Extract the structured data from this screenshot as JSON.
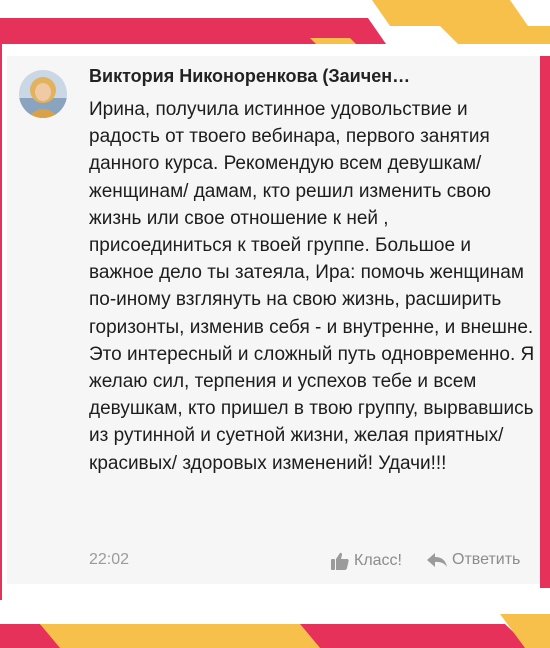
{
  "comment": {
    "author": "Виктория Никоноренкова (Заичен…",
    "text": "Ирина, получила истинное  удовольствие и радость от  твоего  вебинара, первого занятия данного курса.  Рекомендую всем девушкам/ женщинам/ дамам, кто решил изменить свою жизнь или свое отношение к ней , присоединиться к твоей группе. Большое и важное дело ты затеяла, Ира: помочь женщинам по-иному взглянуть на свою жизнь, расширить горизонты, изменив себя - и внутренне, и внешне. Это интересный и сложный путь одновременно. Я желаю сил, терпения и успехов тебе и всем девушкам, кто пришел в твою группу, вырвавшись из рутинной и суетной жизни, желая приятных/ красивых/ здоровых изменений! Удачи!!!",
    "time": "22:02",
    "like_label": "Класс!",
    "reply_label": "Ответить"
  },
  "colors": {
    "accent_pink": "#e6325a",
    "accent_yellow": "#f7c04a",
    "card_bg": "#f6f6f6"
  },
  "icons": [
    "avatar-photo",
    "thumbs-up-icon",
    "reply-arrow-icon"
  ]
}
